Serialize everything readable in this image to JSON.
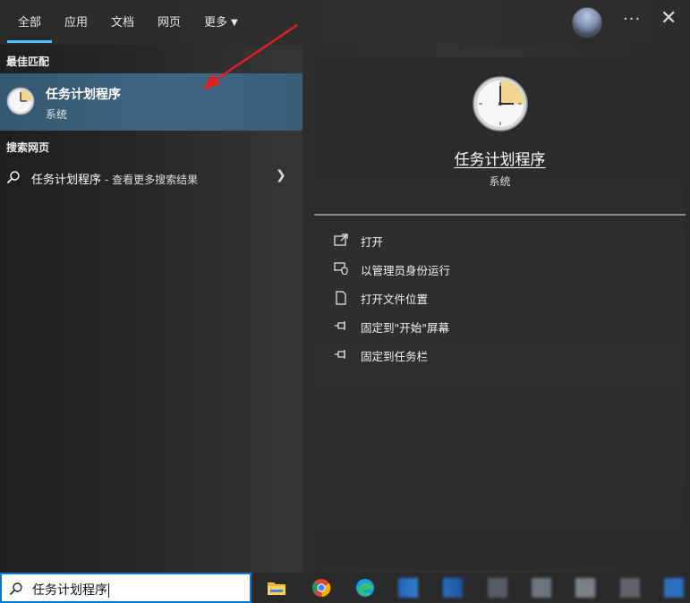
{
  "tabs": [
    {
      "label": "全部",
      "active": true
    },
    {
      "label": "应用"
    },
    {
      "label": "文档"
    },
    {
      "label": "网页"
    },
    {
      "label": "更多"
    }
  ],
  "top_icons": {
    "more": "more-icon",
    "close": "close-icon"
  },
  "best_match": {
    "section_title": "最佳匹配",
    "title": "任务计划程序",
    "subtitle": "系统",
    "icon": "clock-icon"
  },
  "web_search": {
    "section_title": "搜索网页",
    "query": "任务计划程序",
    "suffix": "- 查看更多搜索结果"
  },
  "detail": {
    "title": "任务计划程序",
    "subtitle": "系统",
    "actions": [
      {
        "label": "打开",
        "icon": "open-icon"
      },
      {
        "label": "以管理员身份运行",
        "icon": "shield-icon"
      },
      {
        "label": "打开文件位置",
        "icon": "file-location-icon"
      },
      {
        "label": "固定到\"开始\"屏幕",
        "icon": "pin-icon"
      },
      {
        "label": "固定到任务栏",
        "icon": "pin-icon"
      }
    ]
  },
  "searchbox": {
    "value": "任务计划程序"
  },
  "taskbar_apps": [
    "file-explorer-icon",
    "chrome-icon",
    "edge-icon"
  ],
  "colors": {
    "accent": "#4cc2ff",
    "selection": "#3f6682",
    "annotation_arrow": "#e02020"
  }
}
